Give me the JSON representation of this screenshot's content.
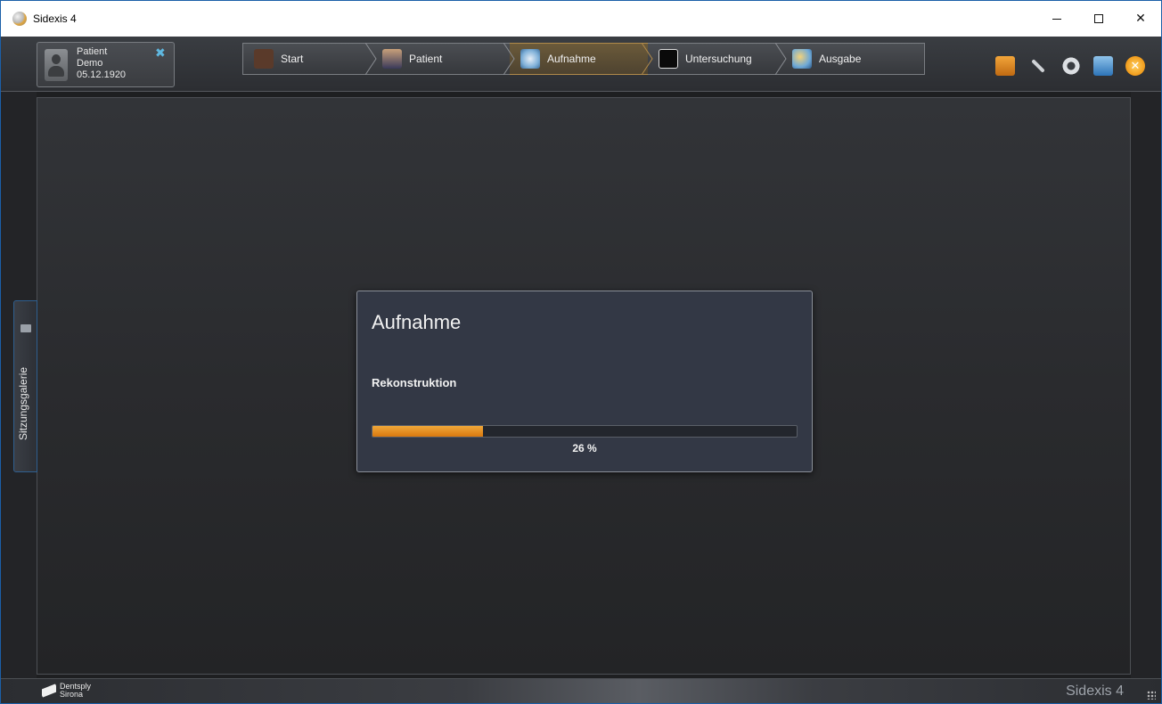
{
  "window": {
    "title": "Sidexis 4",
    "icon": "sidexis-app-icon"
  },
  "patient": {
    "line1": "Patient",
    "line2": "Demo",
    "line3": "05.12.1920"
  },
  "workflow": {
    "steps": [
      {
        "label": "Start",
        "icon": "house-icon"
      },
      {
        "label": "Patient",
        "icon": "person-icon"
      },
      {
        "label": "Aufnahme",
        "icon": "xray-device-icon",
        "active": true
      },
      {
        "label": "Untersuchung",
        "icon": "monitor-icon"
      },
      {
        "label": "Ausgabe",
        "icon": "globe-output-icon"
      }
    ]
  },
  "toolbar_icons": [
    "book-icon",
    "tools-icon",
    "gear-icon",
    "window-icon",
    "exit-icon"
  ],
  "gallery_tab": {
    "label": "Sitzungsgalerie"
  },
  "dialog": {
    "title": "Aufnahme",
    "status": "Rekonstruktion",
    "progress_fraction": 0.26,
    "progress_text": "26 %"
  },
  "footer": {
    "brand_line1": "Dentsply",
    "brand_line2": "Sirona",
    "product": "Sidexis 4"
  },
  "colors": {
    "accent_orange": "#e8901f",
    "dialog_bg": "#333845",
    "window_border": "#1b5fa8"
  }
}
